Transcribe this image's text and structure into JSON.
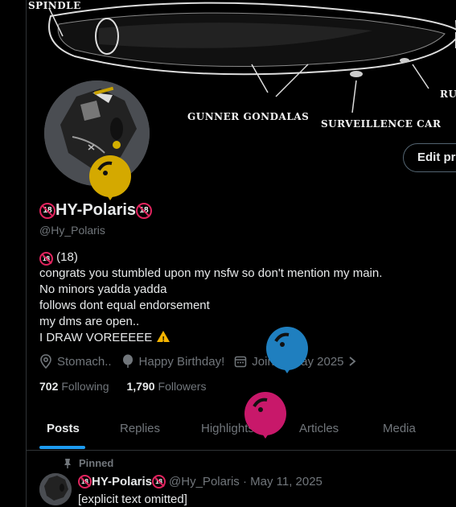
{
  "banner": {
    "labels": [
      "SPINDLE",
      "GUNNER GONDALAS",
      "SURVEILLENCE CAR",
      "RU"
    ]
  },
  "profile": {
    "edit_label": "Edit pro",
    "name": "HY-Polaris",
    "handle": "@Hy_Polaris",
    "bio": {
      "line1_suffix": "(18)",
      "line2": "congrats you stumbled upon my nsfw so don't mention my main.",
      "line3": "No minors yadda yadda",
      "line4": "follows dont equal endorsement",
      "line5": "my dms are open..",
      "line6": "I DRAW VOREEEEE"
    },
    "location": "Stomach..",
    "birthday": "Happy Birthday!",
    "joined": "Joined May 2025",
    "following_count": "702",
    "following_label": "Following",
    "followers_count": "1,790",
    "followers_label": "Followers"
  },
  "tabs": [
    "Posts",
    "Replies",
    "Highlights",
    "Articles",
    "Media"
  ],
  "pinned": {
    "label": "Pinned",
    "name": "HY-Polaris",
    "handle_date": "@Hy_Polaris · May 11, 2025",
    "text": "[explicit text omitted]"
  },
  "colors": {
    "accent": "#1d9bf0",
    "badge": "#e0245e",
    "balloon_yellow": "#d4a900",
    "balloon_blue": "#1f7fbf",
    "balloon_pink": "#c8186a"
  }
}
